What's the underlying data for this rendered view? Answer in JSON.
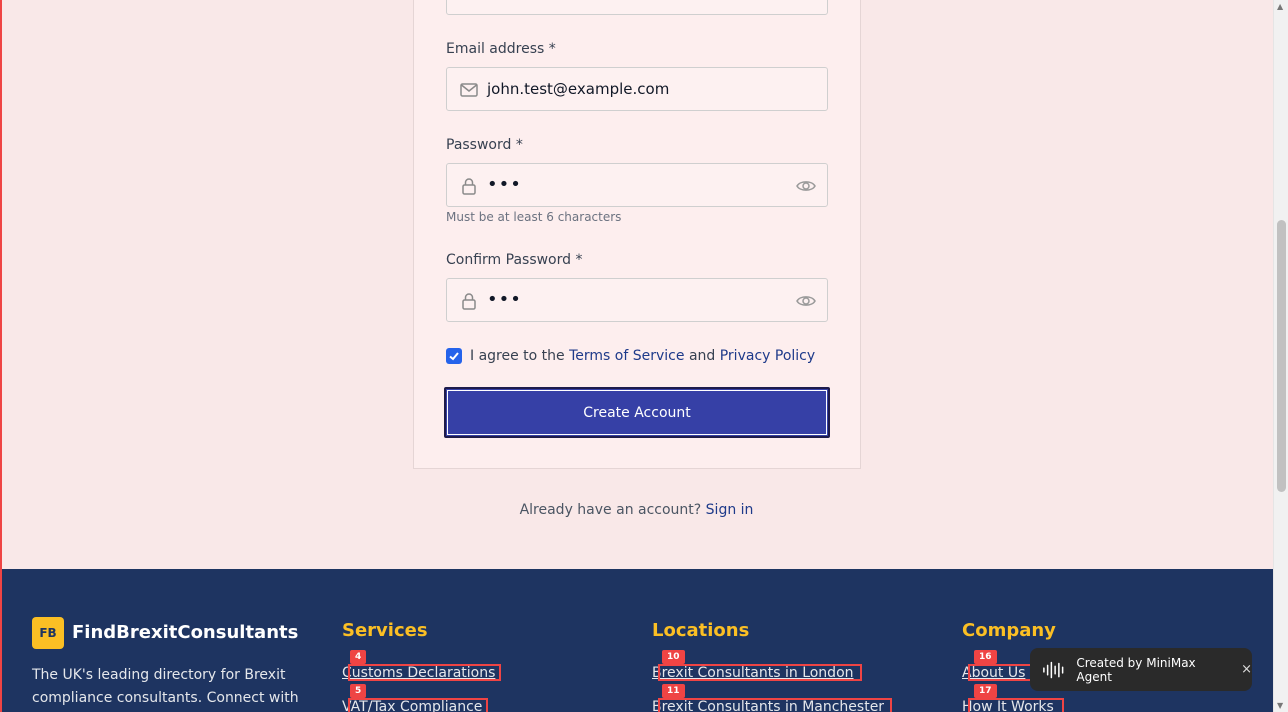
{
  "form": {
    "email_label": "Email address *",
    "email_value": "john.test@example.com",
    "password_label": "Password *",
    "password_value": "•••",
    "password_hint": "Must be at least 6 characters",
    "confirm_label": "Confirm Password *",
    "confirm_value": "•••",
    "agree_prefix": "I agree to the",
    "terms_link": "Terms of Service",
    "agree_and": "and",
    "privacy_link": "Privacy Policy",
    "agree_checked": true,
    "submit_label": "Create Account",
    "signin_prompt": "Already have an account?",
    "signin_link": "Sign in"
  },
  "footer": {
    "logo_mark": "FB",
    "brand": "FindBrexitConsultants",
    "description": "The UK's leading directory for Brexit compliance consultants. Connect with",
    "services_heading": "Services",
    "services": [
      {
        "tag": "4",
        "label": "Customs Declarations"
      },
      {
        "tag": "5",
        "label": "VAT/Tax Compliance"
      }
    ],
    "locations_heading": "Locations",
    "locations": [
      {
        "tag": "10",
        "label": "Brexit Consultants in London"
      },
      {
        "tag": "11",
        "label": "Brexit Consultants in Manchester"
      }
    ],
    "company_heading": "Company",
    "company": [
      {
        "tag": "16",
        "label": "About Us"
      },
      {
        "tag": "17",
        "label": "How It Works"
      }
    ]
  },
  "toast": {
    "text": "Created by MiniMax Agent",
    "close": "×"
  },
  "icons": {
    "email": "mail-icon",
    "password": "lock-icon",
    "reveal": "eye-icon"
  },
  "colors": {
    "primary_button": "#3640a6",
    "footer_bg": "#1e3461",
    "footer_heading": "#fbbf24",
    "annotation_red": "#ef4444"
  }
}
